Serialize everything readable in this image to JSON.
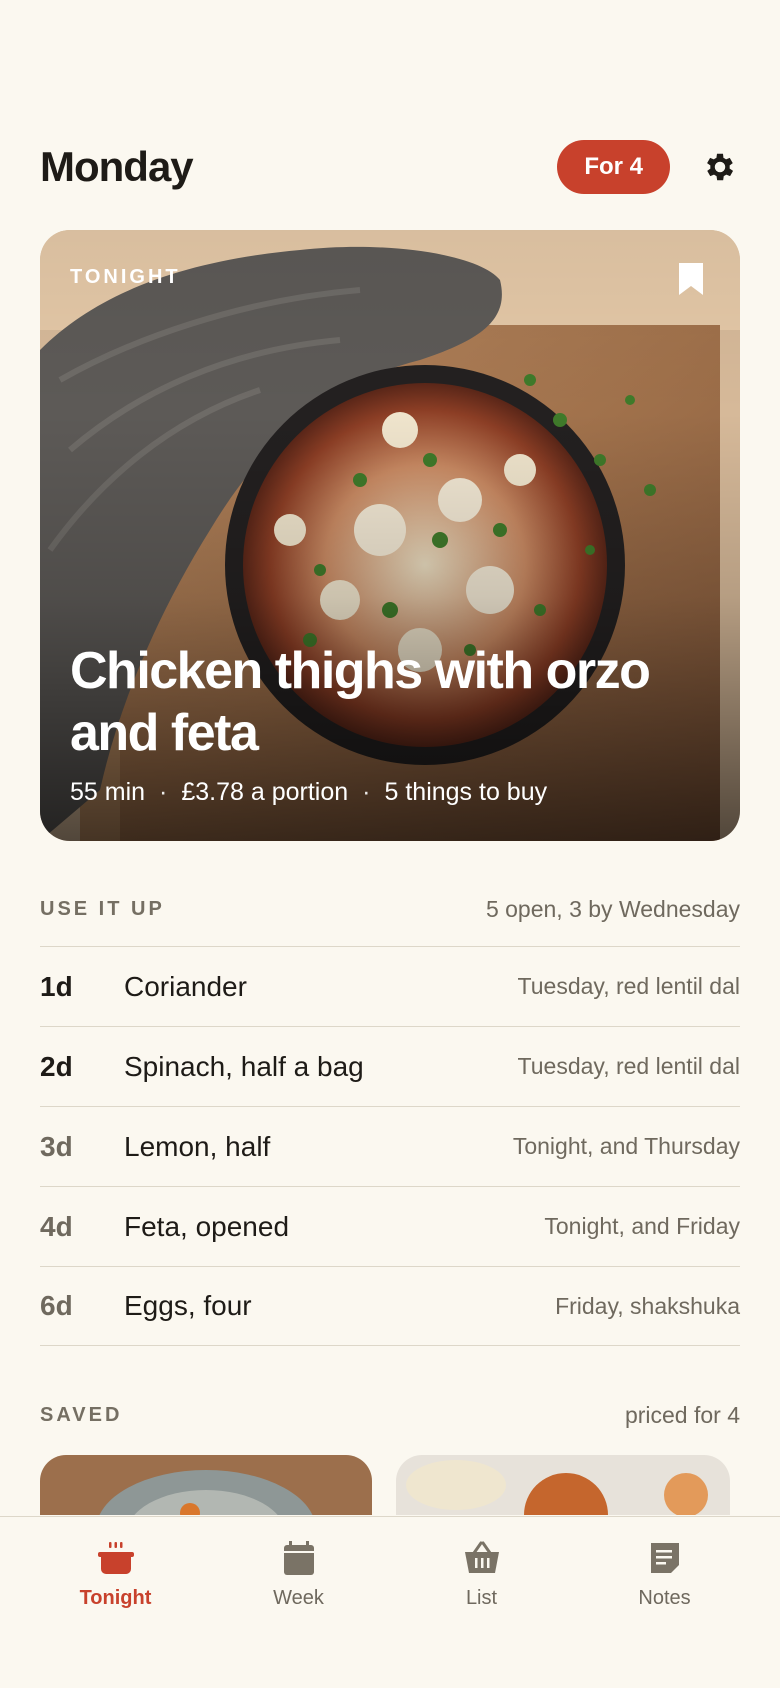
{
  "header": {
    "title": "Monday",
    "servings_label": "For 4",
    "settings_icon": "gear-icon"
  },
  "hero": {
    "tag": "TONIGHT",
    "title": "Chicken thighs with orzo and feta",
    "time": "55 min",
    "price": "£3.78 a portion",
    "to_buy": "5 things to buy",
    "separator": "·",
    "bookmark_icon": "bookmark-icon"
  },
  "use_it_up": {
    "label": "USE IT UP",
    "summary": "5 open, 3 by Wednesday",
    "items": [
      {
        "age": "1d",
        "name": "Coriander",
        "plan": "Tuesday, red lentil dal"
      },
      {
        "age": "2d",
        "name": "Spinach, half a bag",
        "plan": "Tuesday, red lentil dal"
      },
      {
        "age": "3d",
        "name": "Lemon, half",
        "plan": "Tonight, and Thursday"
      },
      {
        "age": "4d",
        "name": "Feta, opened",
        "plan": "Tonight, and Friday"
      },
      {
        "age": "6d",
        "name": "Eggs, four",
        "plan": "Friday, shakshuka"
      }
    ]
  },
  "saved": {
    "label": "SAVED",
    "note": "priced for 4"
  },
  "tabs": [
    {
      "label": "Tonight",
      "icon": "pot-icon",
      "active": true
    },
    {
      "label": "Week",
      "icon": "calendar-icon",
      "active": false
    },
    {
      "label": "List",
      "icon": "basket-icon",
      "active": false
    },
    {
      "label": "Notes",
      "icon": "note-icon",
      "active": false
    }
  ],
  "colors": {
    "accent": "#c8412c",
    "background": "#fbf8f0",
    "muted_text": "#6f695e",
    "divider": "#ddd7c9"
  }
}
